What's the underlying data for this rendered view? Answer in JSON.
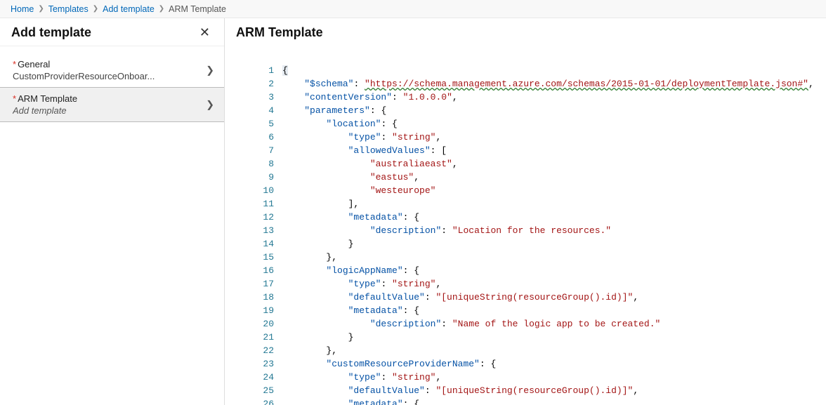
{
  "breadcrumb": {
    "items": [
      "Home",
      "Templates",
      "Add template",
      "ARM Template"
    ]
  },
  "sidebar": {
    "title": "Add template",
    "nav": [
      {
        "label": "General",
        "required": true,
        "sub": "CustomProviderResourceOnboar...",
        "italic": false,
        "selected": false
      },
      {
        "label": "ARM Template",
        "required": true,
        "sub": "Add template",
        "italic": true,
        "selected": true
      }
    ]
  },
  "main": {
    "title": "ARM Template"
  },
  "editor": {
    "lines": [
      [
        {
          "t": "brace",
          "v": "{"
        }
      ],
      [
        {
          "t": "sp",
          "v": "    "
        },
        {
          "t": "key",
          "v": "\"$schema\""
        },
        {
          "t": "punc",
          "v": ": "
        },
        {
          "t": "link",
          "v": "\"https://schema.management.azure.com/schemas/2015-01-01/deploymentTemplate.json#\""
        },
        {
          "t": "punc",
          "v": ","
        }
      ],
      [
        {
          "t": "sp",
          "v": "    "
        },
        {
          "t": "key",
          "v": "\"contentVersion\""
        },
        {
          "t": "punc",
          "v": ": "
        },
        {
          "t": "str",
          "v": "\"1.0.0.0\""
        },
        {
          "t": "punc",
          "v": ","
        }
      ],
      [
        {
          "t": "sp",
          "v": "    "
        },
        {
          "t": "key",
          "v": "\"parameters\""
        },
        {
          "t": "punc",
          "v": ": {"
        }
      ],
      [
        {
          "t": "sp",
          "v": "        "
        },
        {
          "t": "key",
          "v": "\"location\""
        },
        {
          "t": "punc",
          "v": ": {"
        }
      ],
      [
        {
          "t": "sp",
          "v": "            "
        },
        {
          "t": "key",
          "v": "\"type\""
        },
        {
          "t": "punc",
          "v": ": "
        },
        {
          "t": "str",
          "v": "\"string\""
        },
        {
          "t": "punc",
          "v": ","
        }
      ],
      [
        {
          "t": "sp",
          "v": "            "
        },
        {
          "t": "key",
          "v": "\"allowedValues\""
        },
        {
          "t": "punc",
          "v": ": ["
        }
      ],
      [
        {
          "t": "sp",
          "v": "                "
        },
        {
          "t": "str",
          "v": "\"australiaeast\""
        },
        {
          "t": "punc",
          "v": ","
        }
      ],
      [
        {
          "t": "sp",
          "v": "                "
        },
        {
          "t": "str",
          "v": "\"eastus\""
        },
        {
          "t": "punc",
          "v": ","
        }
      ],
      [
        {
          "t": "sp",
          "v": "                "
        },
        {
          "t": "str",
          "v": "\"westeurope\""
        }
      ],
      [
        {
          "t": "sp",
          "v": "            "
        },
        {
          "t": "punc",
          "v": "],"
        }
      ],
      [
        {
          "t": "sp",
          "v": "            "
        },
        {
          "t": "key",
          "v": "\"metadata\""
        },
        {
          "t": "punc",
          "v": ": {"
        }
      ],
      [
        {
          "t": "sp",
          "v": "                "
        },
        {
          "t": "key",
          "v": "\"description\""
        },
        {
          "t": "punc",
          "v": ": "
        },
        {
          "t": "str",
          "v": "\"Location for the resources.\""
        }
      ],
      [
        {
          "t": "sp",
          "v": "            "
        },
        {
          "t": "punc",
          "v": "}"
        }
      ],
      [
        {
          "t": "sp",
          "v": "        "
        },
        {
          "t": "punc",
          "v": "},"
        }
      ],
      [
        {
          "t": "sp",
          "v": "        "
        },
        {
          "t": "key",
          "v": "\"logicAppName\""
        },
        {
          "t": "punc",
          "v": ": {"
        }
      ],
      [
        {
          "t": "sp",
          "v": "            "
        },
        {
          "t": "key",
          "v": "\"type\""
        },
        {
          "t": "punc",
          "v": ": "
        },
        {
          "t": "str",
          "v": "\"string\""
        },
        {
          "t": "punc",
          "v": ","
        }
      ],
      [
        {
          "t": "sp",
          "v": "            "
        },
        {
          "t": "key",
          "v": "\"defaultValue\""
        },
        {
          "t": "punc",
          "v": ": "
        },
        {
          "t": "str",
          "v": "\"[uniqueString(resourceGroup().id)]\""
        },
        {
          "t": "punc",
          "v": ","
        }
      ],
      [
        {
          "t": "sp",
          "v": "            "
        },
        {
          "t": "key",
          "v": "\"metadata\""
        },
        {
          "t": "punc",
          "v": ": {"
        }
      ],
      [
        {
          "t": "sp",
          "v": "                "
        },
        {
          "t": "key",
          "v": "\"description\""
        },
        {
          "t": "punc",
          "v": ": "
        },
        {
          "t": "str",
          "v": "\"Name of the logic app to be created.\""
        }
      ],
      [
        {
          "t": "sp",
          "v": "            "
        },
        {
          "t": "punc",
          "v": "}"
        }
      ],
      [
        {
          "t": "sp",
          "v": "        "
        },
        {
          "t": "punc",
          "v": "},"
        }
      ],
      [
        {
          "t": "sp",
          "v": "        "
        },
        {
          "t": "key",
          "v": "\"customResourceProviderName\""
        },
        {
          "t": "punc",
          "v": ": {"
        }
      ],
      [
        {
          "t": "sp",
          "v": "            "
        },
        {
          "t": "key",
          "v": "\"type\""
        },
        {
          "t": "punc",
          "v": ": "
        },
        {
          "t": "str",
          "v": "\"string\""
        },
        {
          "t": "punc",
          "v": ","
        }
      ],
      [
        {
          "t": "sp",
          "v": "            "
        },
        {
          "t": "key",
          "v": "\"defaultValue\""
        },
        {
          "t": "punc",
          "v": ": "
        },
        {
          "t": "str",
          "v": "\"[uniqueString(resourceGroup().id)]\""
        },
        {
          "t": "punc",
          "v": ","
        }
      ],
      [
        {
          "t": "sp",
          "v": "            "
        },
        {
          "t": "key",
          "v": "\"metadata\""
        },
        {
          "t": "punc",
          "v": ": {"
        }
      ]
    ]
  }
}
